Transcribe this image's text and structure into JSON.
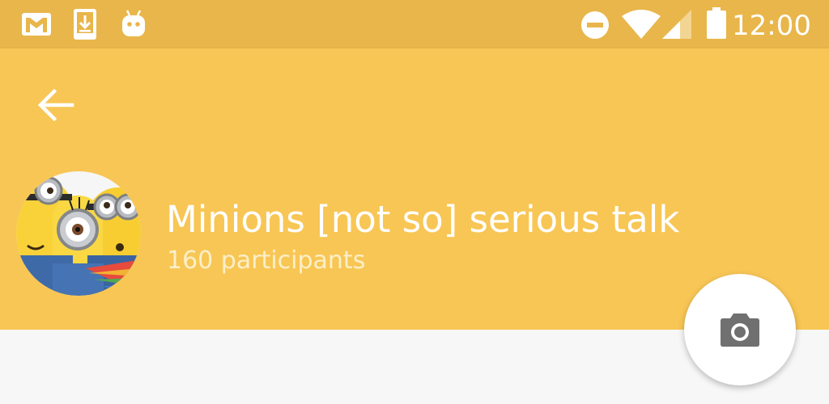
{
  "status_bar": {
    "time": "12:00",
    "notification_icons": [
      "gmail-icon",
      "download-icon",
      "android-icon"
    ],
    "system_icons": [
      "do-not-disturb-icon",
      "wifi-icon",
      "cell-signal-icon",
      "battery-icon"
    ],
    "background_color": "#e8b64a"
  },
  "header": {
    "background_color": "#f8c655",
    "back_icon": "arrow-back-icon",
    "group_name": "Minions [not so] serious talk",
    "participants": "160 participants"
  },
  "fab": {
    "icon": "camera-icon",
    "background_color": "#ffffff"
  }
}
